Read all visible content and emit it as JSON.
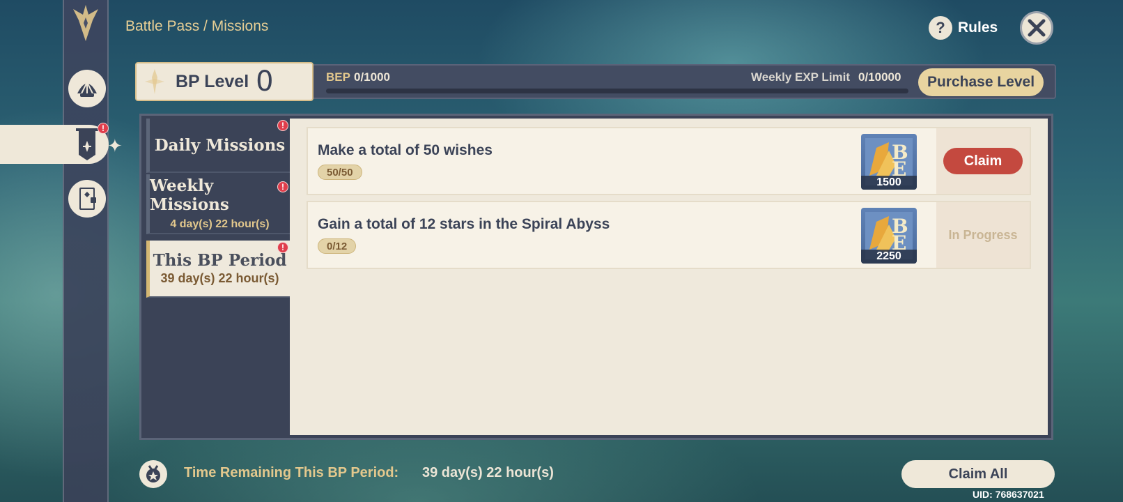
{
  "header": {
    "breadcrumb": "Battle Pass / Missions",
    "rules_label": "Rules",
    "rules_icon": "?"
  },
  "level": {
    "label": "BP Level",
    "value": "0",
    "bep_label": "BEP",
    "bep_value": "0/1000",
    "bep_progress": 0,
    "weekly_label": "Weekly EXP Limit",
    "weekly_value": "0/10000",
    "purchase_label": "Purchase Level"
  },
  "sidebar": {
    "items": [
      {
        "icon": "battle-pass-emblem-icon"
      },
      {
        "icon": "shell-icon"
      },
      {
        "icon": "banner-icon",
        "active": true,
        "alert": true
      },
      {
        "icon": "notebook-icon"
      }
    ]
  },
  "nav": {
    "alert_glyph": "!",
    "tabs": [
      {
        "title": "Daily Missions",
        "subtitle": ""
      },
      {
        "title": "Weekly Missions",
        "subtitle": "4 day(s) 22 hour(s)"
      },
      {
        "title": "This BP Period",
        "subtitle": "39 day(s) 22 hour(s)"
      }
    ]
  },
  "missions": [
    {
      "title": "Make a total of 50 wishes",
      "progress": "50/50",
      "reward_icon": "bep-reward-icon",
      "reward_amount": "1500",
      "action": "Claim"
    },
    {
      "title": "Gain a total of 12 stars in the Spiral Abyss",
      "progress": "0/12",
      "reward_icon": "bep-reward-icon",
      "reward_amount": "2250",
      "action": "In Progress"
    }
  ],
  "footer": {
    "time_label": "Time Remaining This BP Period:",
    "time_value": "39 day(s) 22 hour(s)",
    "claim_all_label": "Claim All",
    "uid": "UID: 768637021"
  },
  "colors": {
    "accent_gold": "#e3c88d",
    "panel_dark": "#3b4357",
    "panel_light": "#efe9dc",
    "claim_red": "#c4493f",
    "alert_red": "#e03e4c"
  }
}
